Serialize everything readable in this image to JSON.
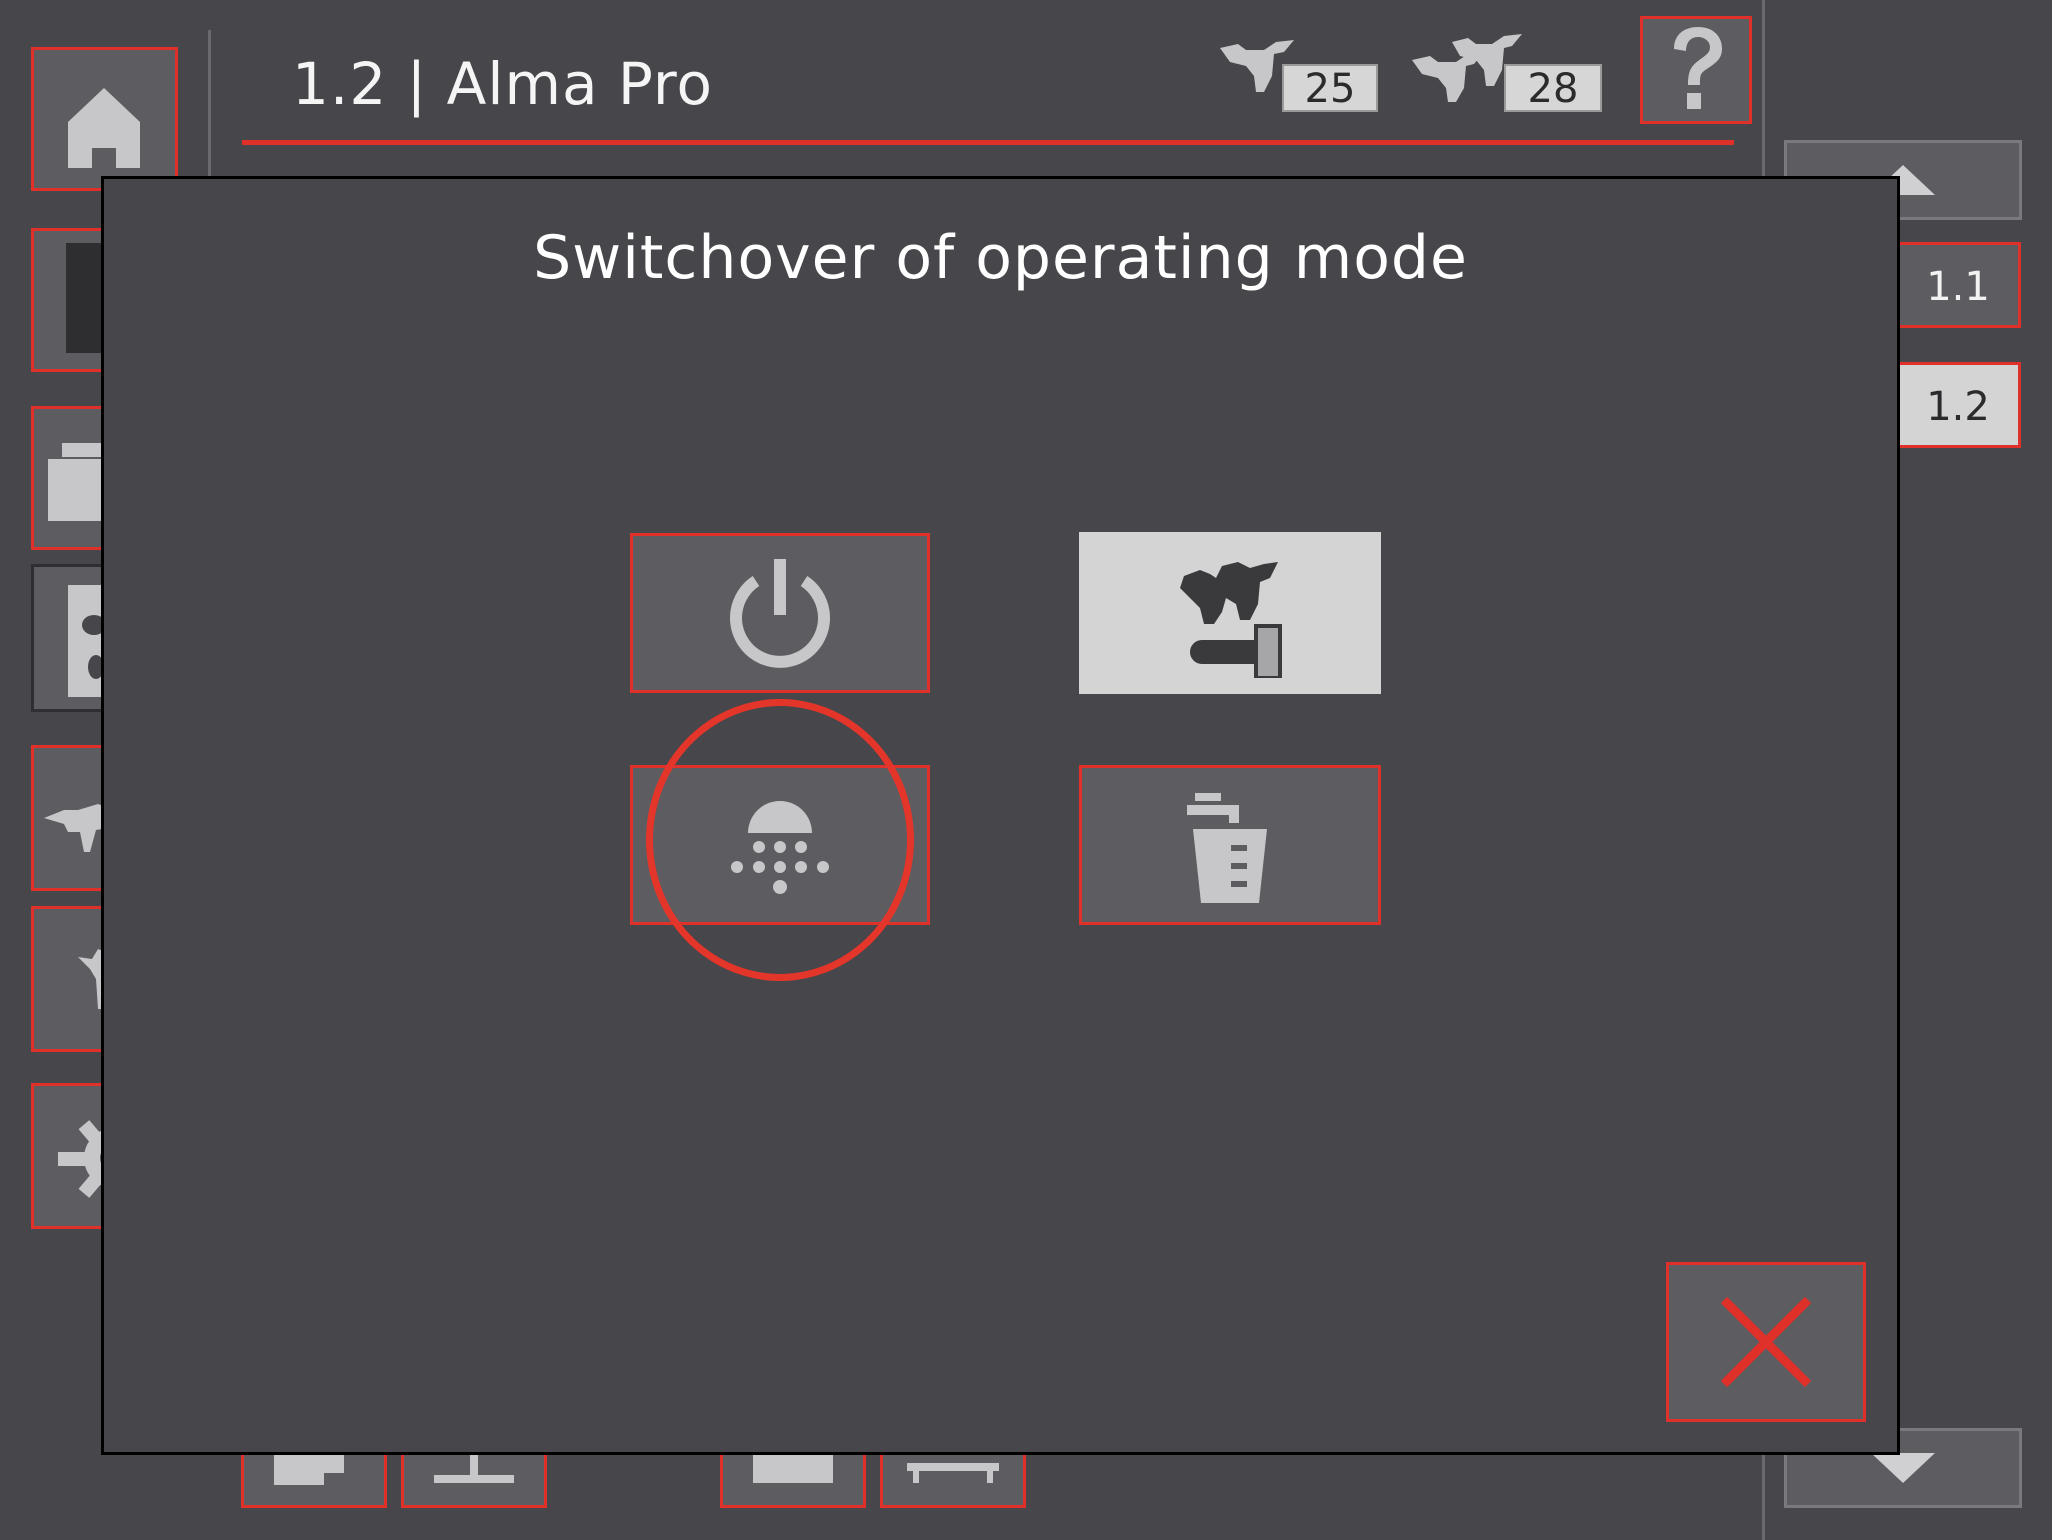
{
  "header": {
    "title": "1.2 | Alma Pro",
    "badge_single_count": "25",
    "badge_group_count": "28",
    "help_icon": "question-mark-icon"
  },
  "right_nav": {
    "items": [
      {
        "label": "1.1"
      },
      {
        "label": "1.2"
      }
    ],
    "scroll_up_icon": "arrow-up-icon",
    "scroll_down_icon": "arrow-down-icon"
  },
  "left_sidebar": {
    "icons": [
      "home-icon",
      "cabinet-icon",
      "folders-icon",
      "cow-document-icon",
      "cow-icon",
      "cow-side-icon",
      "gear-icon"
    ]
  },
  "dialog": {
    "title": "Switchover of operating mode",
    "modes": [
      {
        "name": "power",
        "icon": "power-icon",
        "active": false
      },
      {
        "name": "milking",
        "icon": "cow-milking-icon",
        "active": true
      },
      {
        "name": "rinse",
        "icon": "shower-rinse-icon",
        "active": false,
        "highlighted": true
      },
      {
        "name": "fill",
        "icon": "tap-bucket-icon",
        "active": false
      }
    ],
    "close_icon": "close-x-icon"
  },
  "colors": {
    "background": "#47464a",
    "accent_red": "#e0302a",
    "button_grey": "#5d5c61",
    "active_button": "#d4d4d4",
    "icon_grey": "#c7c7c9"
  }
}
